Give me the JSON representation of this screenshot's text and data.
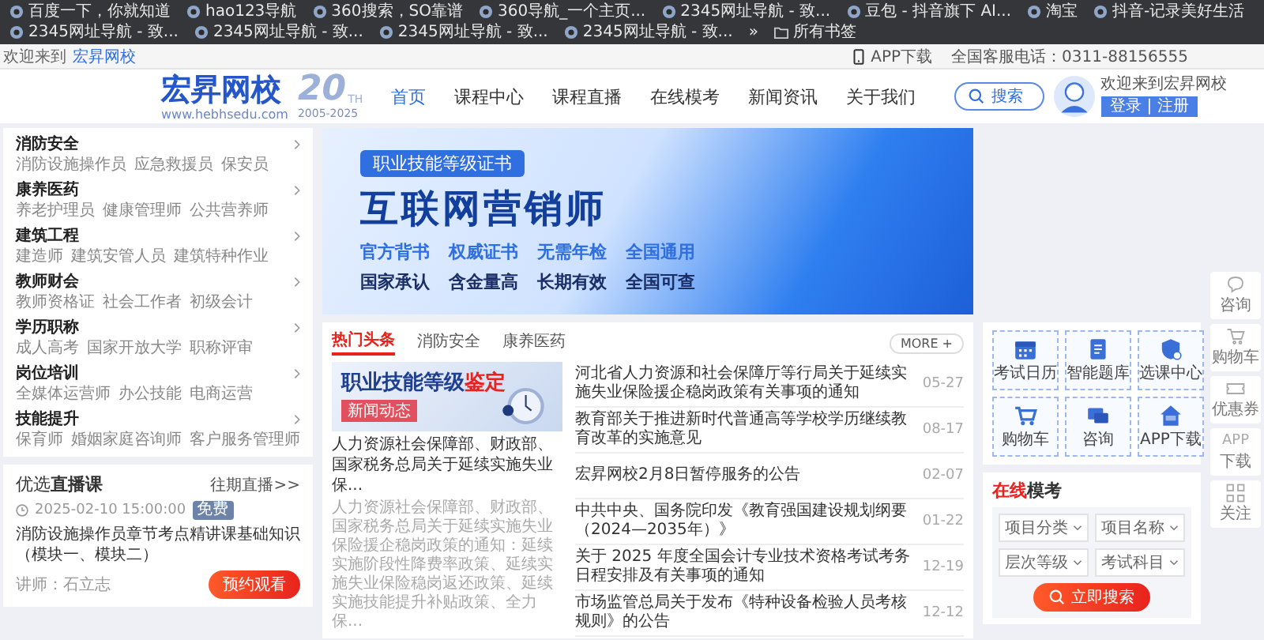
{
  "bookmarks": [
    {
      "label": "百度一下，你就知道"
    },
    {
      "label": "hao123导航"
    },
    {
      "label": "360搜索，SO靠谱"
    },
    {
      "label": "360导航_一个主页..."
    },
    {
      "label": "2345网址导航 - 致..."
    },
    {
      "label": "豆包 - 抖音旗下 AI..."
    },
    {
      "label": "淘宝"
    },
    {
      "label": "抖音-记录美好生活"
    },
    {
      "label": "2345网址导航 - 致..."
    },
    {
      "label": "2345网址导航 - 致..."
    },
    {
      "label": "2345网址导航 - 致..."
    },
    {
      "label": "2345网址导航 - 致..."
    }
  ],
  "bookmarks_more": "»",
  "all_bookmarks": "所有书签",
  "top_bar": {
    "welcome": "欢迎来到",
    "site_link": "宏昇网校",
    "app_download": "APP下载",
    "hotline": "全国客服电话：0311-88156555"
  },
  "header": {
    "logo": "宏昇网校",
    "anniversary": "20",
    "anniversary_suffix": "TH",
    "domain": "www.hebhsedu.com",
    "years": "2005-2025",
    "nav": [
      {
        "label": "首页",
        "selected": true
      },
      {
        "label": "课程中心",
        "selected": false
      },
      {
        "label": "课程直播",
        "selected": false
      },
      {
        "label": "在线模考",
        "selected": false
      },
      {
        "label": "新闻资讯",
        "selected": false
      },
      {
        "label": "关于我们",
        "selected": false
      }
    ],
    "search_button": "搜索",
    "user_greeting": "欢迎来到宏昇网校",
    "login_button": "登录 | 注册"
  },
  "category_menu": [
    {
      "title": "消防安全",
      "items": [
        "消防设施操作员",
        "应急救援员",
        "保安员"
      ]
    },
    {
      "title": "康养医药",
      "items": [
        "养老护理员",
        "健康管理师",
        "公共营养师"
      ]
    },
    {
      "title": "建筑工程",
      "items": [
        "建造师",
        "建筑安管人员",
        "建筑特种作业"
      ]
    },
    {
      "title": "教师财会",
      "items": [
        "教师资格证",
        "社会工作者",
        "初级会计"
      ]
    },
    {
      "title": "学历职称",
      "items": [
        "成人高考",
        "国家开放大学",
        "职称评审"
      ]
    },
    {
      "title": "岗位培训",
      "items": [
        "全媒体运营师",
        "办公技能",
        "电商运营"
      ]
    },
    {
      "title": "技能提升",
      "items": [
        "保育师",
        "婚姻家庭咨询师",
        "客户服务管理师"
      ]
    }
  ],
  "banner": {
    "tag": "职业技能等级证书",
    "headline": "互联网营销师",
    "features_primary": [
      "官方背书",
      "权威证书",
      "无需年检",
      "全国通用"
    ],
    "features_secondary": [
      "国家承认",
      "含金量高",
      "长期有效",
      "全国可查"
    ]
  },
  "live_course": {
    "title": "优选**直播课**",
    "more_link": "往期直播>>",
    "time": "2025-02-10 15:00:00",
    "badge": "免费",
    "course_title": "消防设施操作员章节考点精讲课基础知识（模块一、模块二）",
    "teacher": "讲师：石立志",
    "button": "预约观看"
  },
  "news": {
    "tabs": [
      {
        "label": "热门头条",
        "selected": true
      },
      {
        "label": "消防安全",
        "selected": false
      },
      {
        "label": "康养医药",
        "selected": false
      }
    ],
    "more": "MORE +",
    "featured": {
      "image_title": "职业技能等级",
      "image_title_accent": "鉴定",
      "image_tag": "新闻动态",
      "title": "人力资源社会保障部、财政部、国家税务总局关于延续实施失业保...",
      "summary": "人力资源社会保障部、财政部、国家税务总局关于延续实施失业保险援企稳岗政策的通知：延续实施阶段性降费率政策、延续实施失业保险稳岗返还政策、延续实施技能提升补贴政策、全力保..."
    },
    "items": [
      {
        "title": "河北省人力资源和社会保障厅等行局关于延续实施失业保险援企稳岗政策有关事项的通知",
        "date": "05-27"
      },
      {
        "title": "教育部关于推进新时代普通高等学校学历继续教育改革的实施意见",
        "date": "08-17"
      },
      {
        "title": "宏昇网校2月8日暂停服务的公告",
        "date": "02-07"
      },
      {
        "title": "中共中央、国务院印发《教育强国建设规划纲要（2024—2035年）》",
        "date": "01-22"
      },
      {
        "title": "关于 2025 年度全国会计专业技术资格考试考务日程安排及有关事项的通知",
        "date": "12-19"
      },
      {
        "title": "市场监管总局关于发布《特种设备检验人员考核规则》的公告",
        "date": "12-12"
      }
    ]
  },
  "quick_links": [
    {
      "label": "考试日历",
      "kind": "calendar"
    },
    {
      "label": "智能题库",
      "kind": "document"
    },
    {
      "label": "选课中心",
      "kind": "shield"
    },
    {
      "label": "购物车",
      "kind": "cart"
    },
    {
      "label": "咨询",
      "kind": "chat"
    },
    {
      "label": "APP下载",
      "kind": "app"
    }
  ],
  "exam_search": {
    "title_accent": "在线",
    "title": "模考",
    "filters": [
      "项目分类",
      "项目名称",
      "层次等级",
      "考试科目"
    ],
    "button": "立即搜索"
  },
  "float_bar": [
    {
      "label": "咨询",
      "kind": "chat"
    },
    {
      "label": "购物车",
      "kind": "cart"
    },
    {
      "label": "优惠券",
      "kind": "coupon"
    },
    {
      "label": "下载",
      "kind": "app",
      "icon_text": "APP"
    },
    {
      "label": "关注",
      "kind": "qr"
    }
  ]
}
